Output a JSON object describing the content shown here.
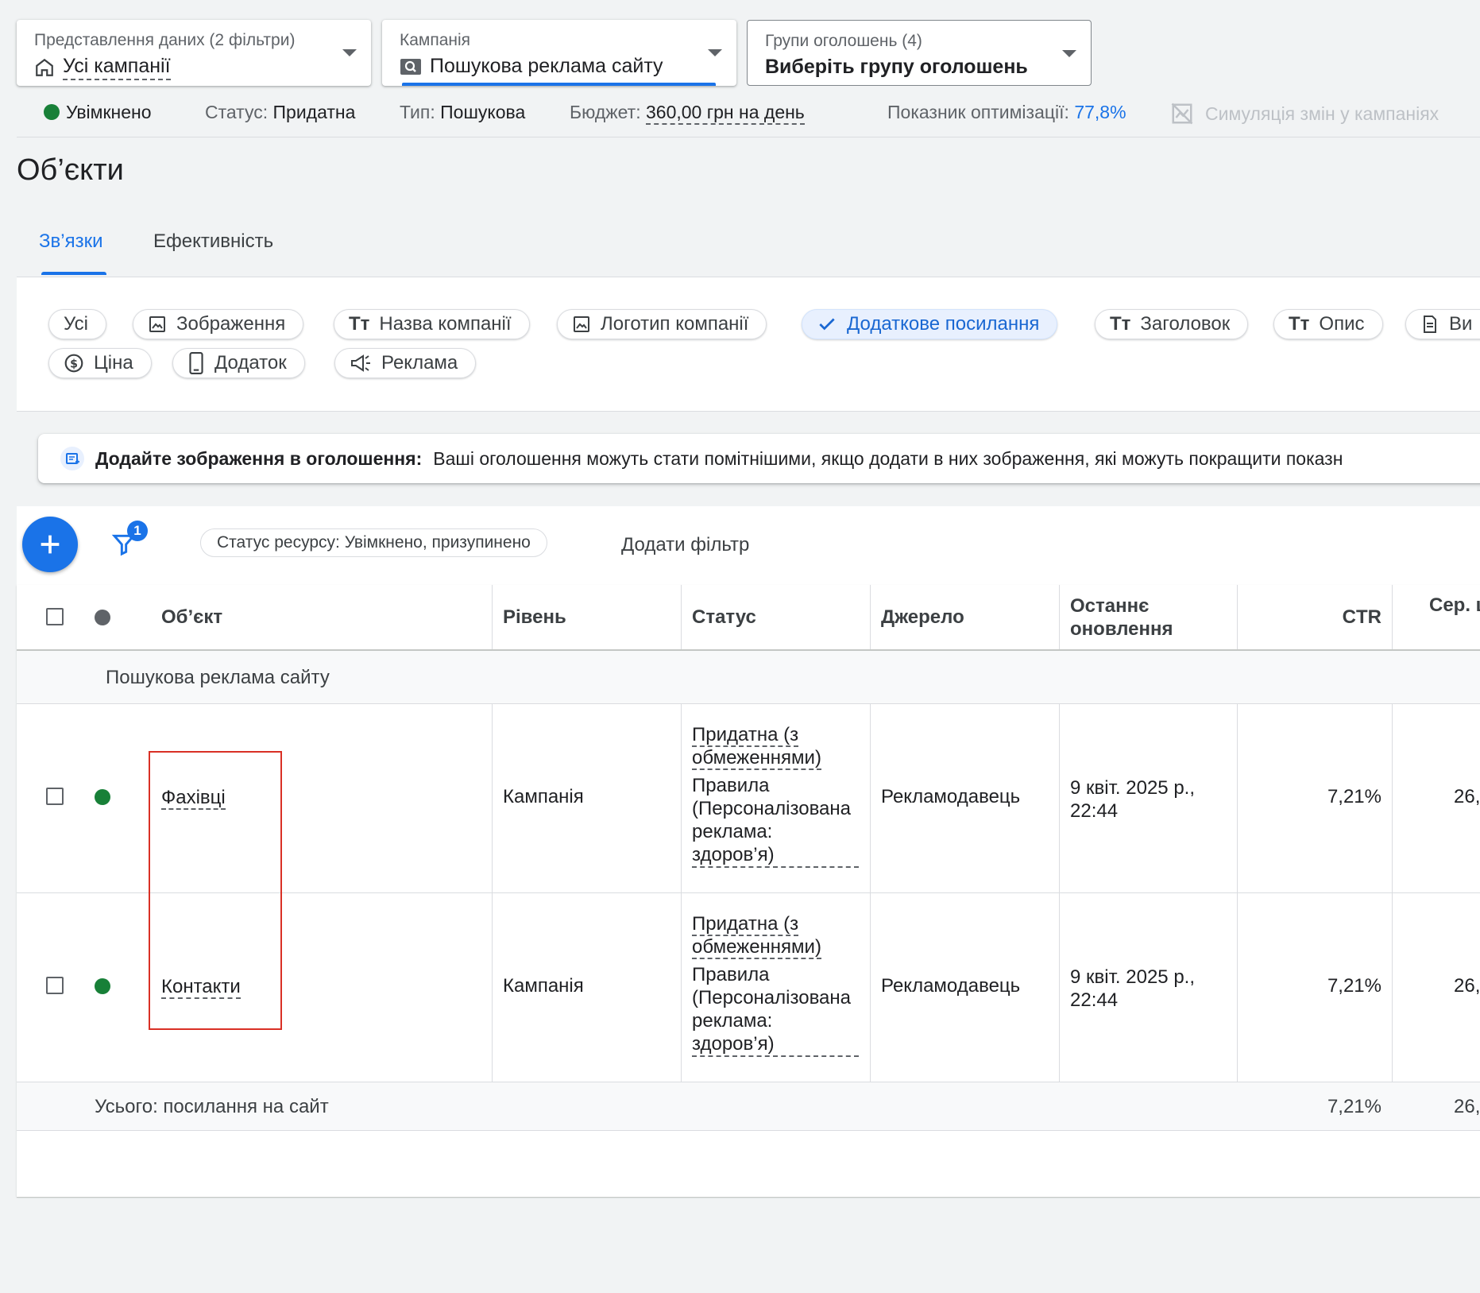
{
  "selectors": {
    "view": {
      "label": "Представлення даних (2 фільтри)",
      "value": "Усі кампанії",
      "icon": "home-icon"
    },
    "campaign": {
      "label": "Кампанія",
      "value": "Пошукова реклама сайту",
      "icon": "search-campaign-icon"
    },
    "adgroup": {
      "label": "Групи оголошень (4)",
      "value": "Виберіть групу оголошень"
    }
  },
  "status_bar": {
    "enabled": "Увімкнено",
    "status_label": "Статус:",
    "status_value": "Придатна",
    "type_label": "Тип:",
    "type_value": "Пошукова",
    "budget_label": "Бюджет:",
    "budget_value": "360,00 грн на день",
    "optimization_label": "Показник оптимізації:",
    "optimization_value": "77,8%",
    "simulation": "Симуляція змін у кампаніях"
  },
  "page_title": "Об’єкти",
  "tabs": [
    {
      "label": "Зв’язки",
      "active": true
    },
    {
      "label": "Ефективність",
      "active": false
    }
  ],
  "chips": [
    {
      "label": "Усі",
      "icon": "none"
    },
    {
      "label": "Зображення",
      "icon": "image-icon"
    },
    {
      "label": "Назва компанії",
      "icon": "text-icon"
    },
    {
      "label": "Логотип компанії",
      "icon": "image-icon"
    },
    {
      "label": "Додаткове посилання",
      "icon": "check-icon",
      "selected": true
    },
    {
      "label": "Заголовок",
      "icon": "text-icon"
    },
    {
      "label": "Опис",
      "icon": "text-icon"
    },
    {
      "label": "Ви",
      "icon": "document-icon"
    },
    {
      "label": "Ціна",
      "icon": "price-icon"
    },
    {
      "label": "Додаток",
      "icon": "phone-icon"
    },
    {
      "label": "Реклама",
      "icon": "megaphone-icon"
    }
  ],
  "banner": {
    "title": "Додайте зображення в оголошення:",
    "text": "Ваші оголошення можуть стати помітнішими, якщо додати в них зображення, які можуть покращити показн"
  },
  "toolbar": {
    "filter_count": "1",
    "filter_chip": "Статус ресурсу: Увімкнено, призупинено",
    "add_filter": "Додати фільтр"
  },
  "table": {
    "headers": {
      "object": "Об’єкт",
      "level": "Рівень",
      "status": "Статус",
      "source": "Джерело",
      "updated": "Останнє оновлення",
      "ctr": "CTR",
      "avg": "Сер. ц"
    },
    "group_label": "Пошукова реклама сайту",
    "rows": [
      {
        "name": "Фахівці",
        "level": "Кампанія",
        "status_1": "Придатна (з обмеженнями)",
        "status_2": "Правила (Персоналізована реклама: здоров’я)",
        "source": "Рекламодавець",
        "updated": "9 квіт. 2025 р., 22:44",
        "ctr": "7,21%",
        "avg": "26,"
      },
      {
        "name": "Контакти",
        "level": "Кампанія",
        "status_1": "Придатна (з обмеженнями)",
        "status_2": "Правила (Персоналізована реклама: здоров’я)",
        "source": "Рекламодавець",
        "updated": "9 квіт. 2025 р., 22:44",
        "ctr": "7,21%",
        "avg": "26,"
      }
    ],
    "total": {
      "label": "Усього: посилання на сайт",
      "ctr": "7,21%",
      "avg": "26,"
    }
  },
  "colors": {
    "accent": "#1a73e8",
    "enabled": "#188038",
    "highlight": "#d93025"
  }
}
